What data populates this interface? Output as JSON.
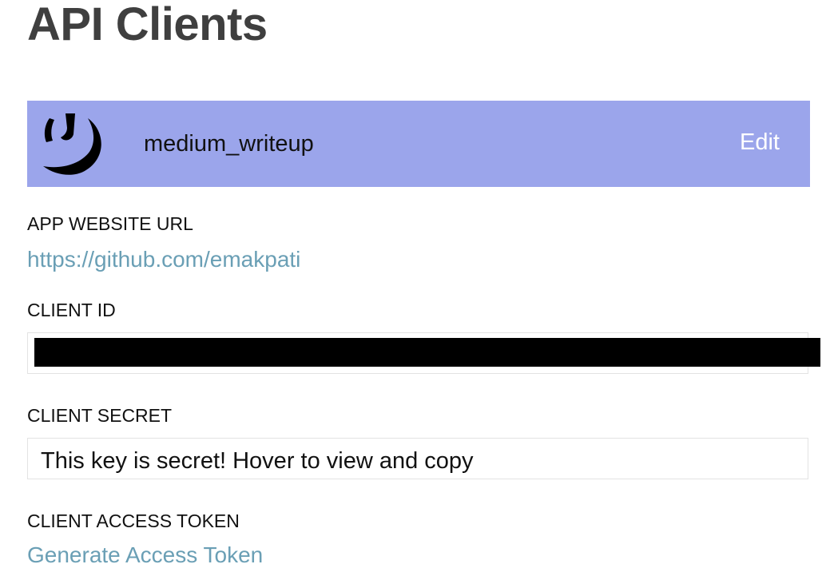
{
  "page": {
    "title": "API Clients"
  },
  "client": {
    "name": "medium_writeup",
    "edit_label": "Edit",
    "header_color": "#9ba5eb",
    "avatar_icon": "logo-face-icon"
  },
  "fields": {
    "website_label": "APP WEBSITE URL",
    "website_url": "https://github.com/emakpati",
    "client_id_label": "CLIENT ID",
    "client_secret_label": "CLIENT SECRET",
    "client_secret_value": "This key is secret! Hover to view and copy",
    "access_token_label": "CLIENT ACCESS TOKEN",
    "generate_token_label": "Generate Access Token"
  },
  "colors": {
    "link": "#6a9fb5",
    "title": "#3f3f3f"
  }
}
